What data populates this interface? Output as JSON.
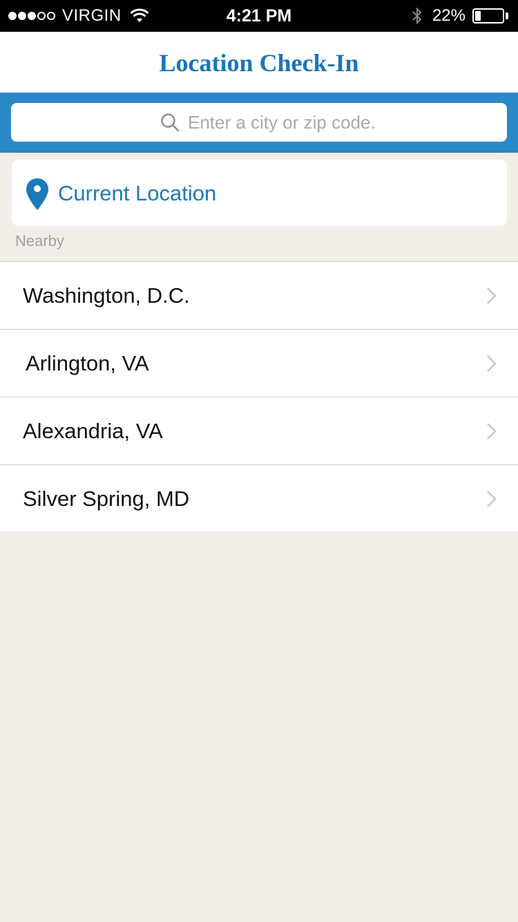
{
  "status_bar": {
    "signal_filled": 3,
    "signal_total": 5,
    "carrier": "VIRGIN",
    "time": "4:21 PM",
    "battery_percent": "22%",
    "battery_level": 0.22
  },
  "header": {
    "title": "Location Check-In"
  },
  "search": {
    "placeholder": "Enter a city or zip code."
  },
  "current_location": {
    "label": "Current Location"
  },
  "nearby": {
    "section_label": "Nearby",
    "items": [
      {
        "label": "Washington, D.C."
      },
      {
        "label": "Arlington, VA"
      },
      {
        "label": "Alexandria, VA"
      },
      {
        "label": "Silver Spring, MD"
      }
    ]
  },
  "colors": {
    "accent": "#1a75b7",
    "search_band": "#2b88c8",
    "background": "#f1eee7"
  },
  "icons": [
    "wifi-icon",
    "bluetooth-icon",
    "battery-icon",
    "search-icon",
    "location-pin-icon",
    "chevron-right-icon"
  ]
}
